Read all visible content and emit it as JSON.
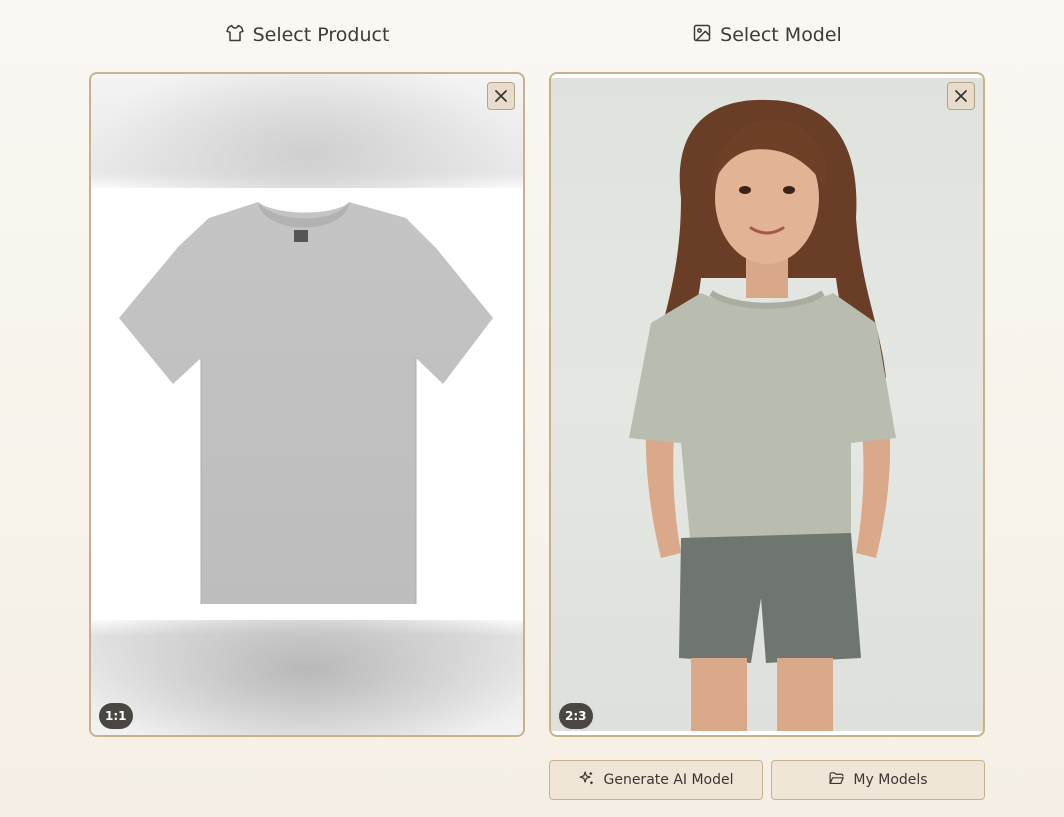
{
  "columns": {
    "product": {
      "title": "Select Product",
      "icon": "shirt-icon",
      "aspect_ratio": "1:1"
    },
    "model": {
      "title": "Select Model",
      "icon": "image-icon",
      "aspect_ratio": "2:3"
    }
  },
  "actions": {
    "generate_label": "Generate AI Model",
    "generate_icon": "sparkles-icon",
    "my_models_label": "My Models",
    "my_models_icon": "folder-icon"
  },
  "colors": {
    "card_border": "#c9b28b",
    "button_bg": "#efe6d8",
    "badge_bg": "#4a4642"
  }
}
